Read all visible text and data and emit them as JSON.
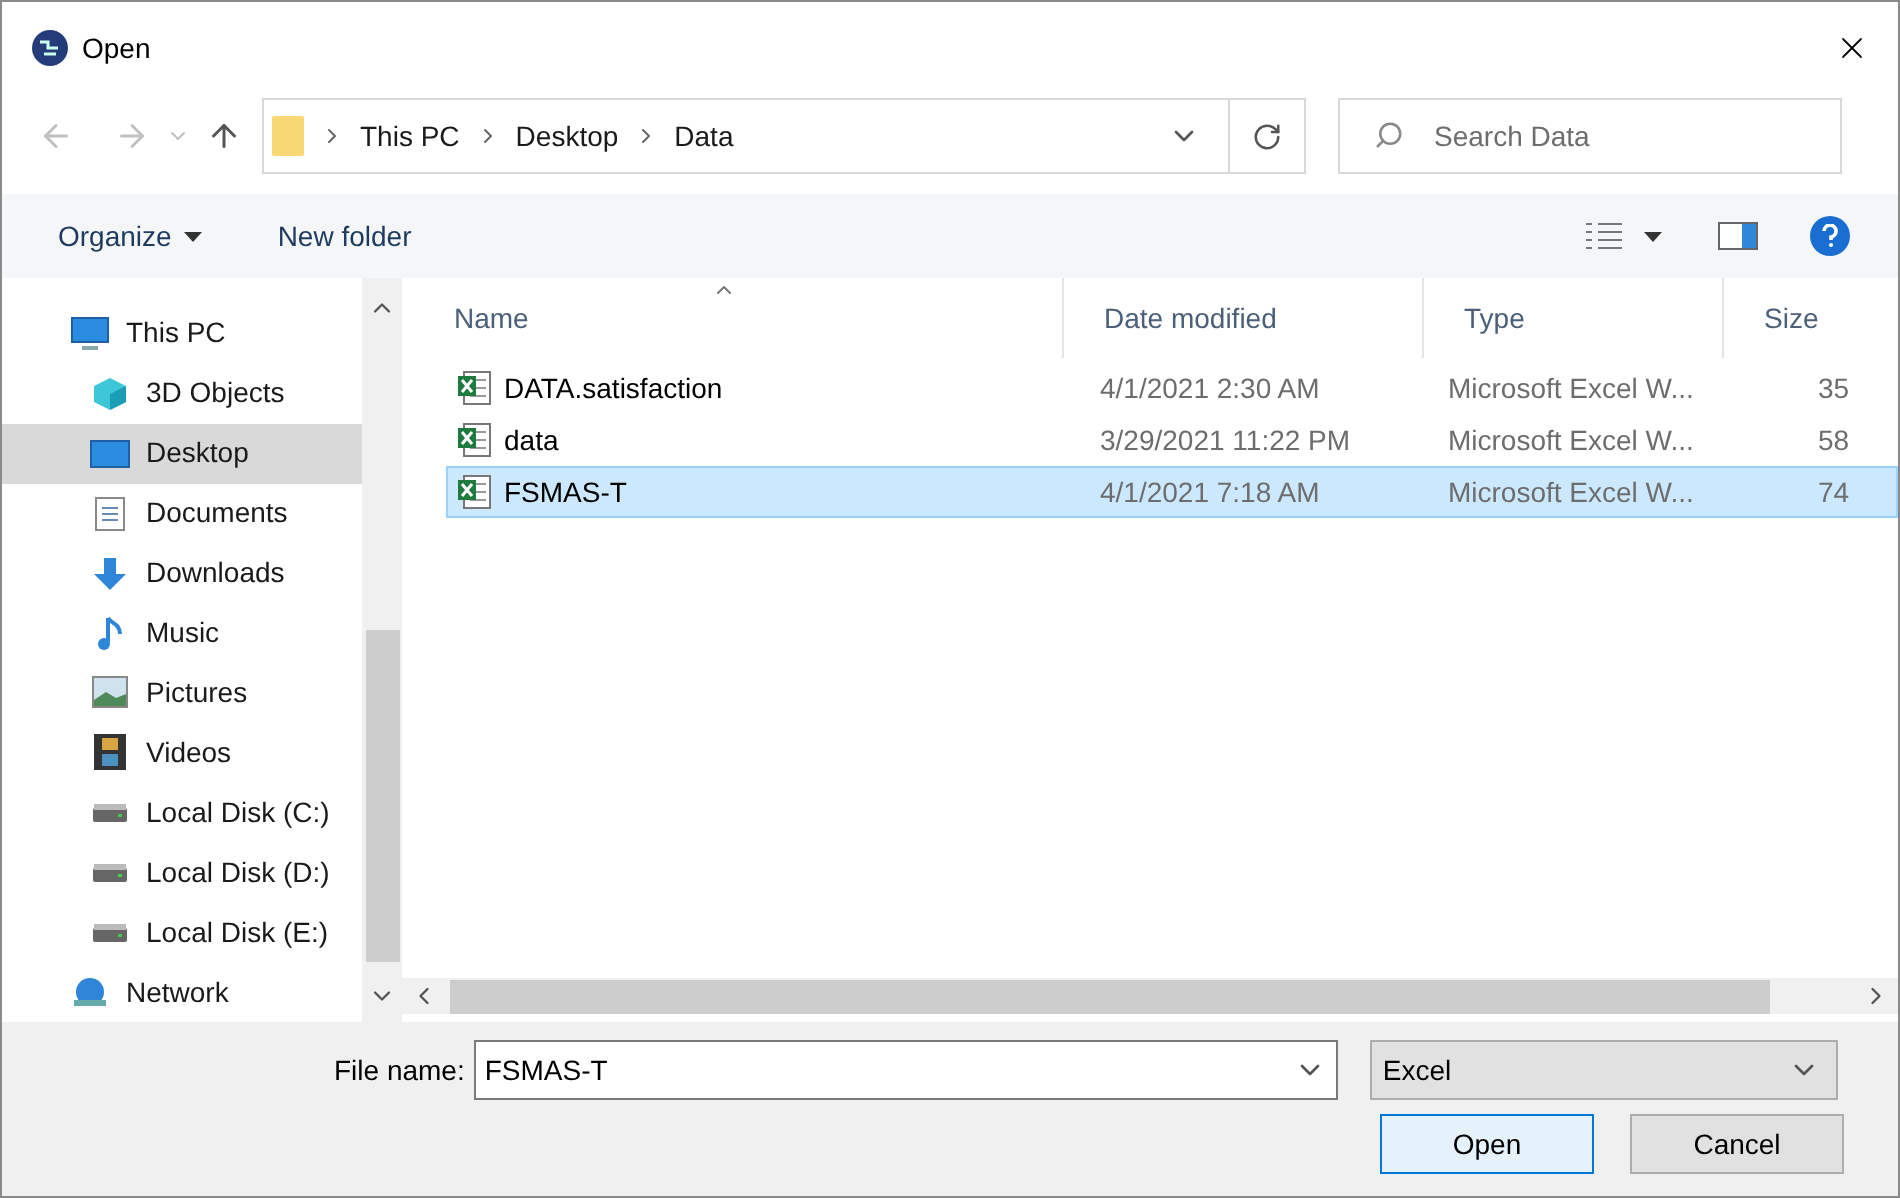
{
  "window": {
    "title": "Open"
  },
  "address": {
    "path": [
      "This PC",
      "Desktop",
      "Data"
    ]
  },
  "search": {
    "placeholder": "Search Data"
  },
  "toolbar": {
    "organize": "Organize",
    "new_folder": "New folder"
  },
  "sidebar": {
    "items": [
      {
        "label": "This PC",
        "kind": "pc",
        "selected": false,
        "children": [
          {
            "label": "3D Objects",
            "kind": "cube",
            "selected": false
          },
          {
            "label": "Desktop",
            "kind": "desktop",
            "selected": true
          },
          {
            "label": "Documents",
            "kind": "document",
            "selected": false
          },
          {
            "label": "Downloads",
            "kind": "download",
            "selected": false
          },
          {
            "label": "Music",
            "kind": "music",
            "selected": false
          },
          {
            "label": "Pictures",
            "kind": "picture",
            "selected": false
          },
          {
            "label": "Videos",
            "kind": "video",
            "selected": false
          },
          {
            "label": "Local Disk (C:)",
            "kind": "disk",
            "selected": false
          },
          {
            "label": "Local Disk (D:)",
            "kind": "disk",
            "selected": false
          },
          {
            "label": "Local Disk (E:)",
            "kind": "disk",
            "selected": false
          }
        ]
      },
      {
        "label": "Network",
        "kind": "network",
        "selected": false
      }
    ]
  },
  "table": {
    "columns": [
      {
        "label": "Name",
        "sorted": true
      },
      {
        "label": "Date modified",
        "sorted": false
      },
      {
        "label": "Type",
        "sorted": false
      },
      {
        "label": "Size",
        "sorted": false
      }
    ],
    "rows": [
      {
        "name": "DATA.satisfaction",
        "date": "4/1/2021 2:30 AM",
        "type": "Microsoft Excel W...",
        "size": "35",
        "selected": false
      },
      {
        "name": "data",
        "date": "3/29/2021 11:22 PM",
        "type": "Microsoft Excel W...",
        "size": "58",
        "selected": false
      },
      {
        "name": "FSMAS-T",
        "date": "4/1/2021 7:18 AM",
        "type": "Microsoft Excel W...",
        "size": "74",
        "selected": true
      }
    ]
  },
  "file_name": {
    "label": "File name:",
    "value": "FSMAS-T"
  },
  "file_type": {
    "value": "Excel"
  },
  "buttons": [
    "Open",
    "Cancel"
  ]
}
